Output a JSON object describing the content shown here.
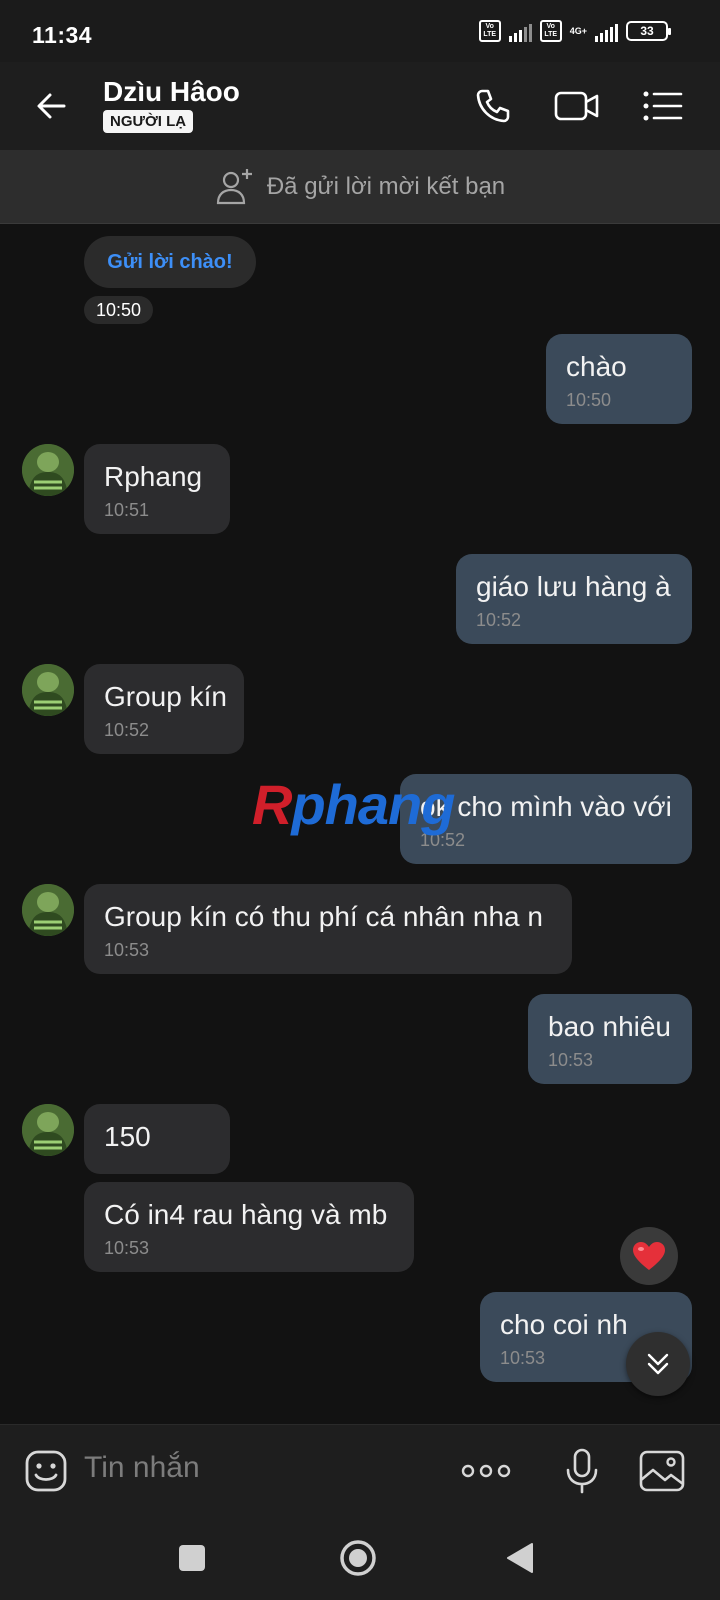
{
  "status_bar": {
    "time": "11:34",
    "volte_1": "Vo LTE",
    "volte_2": "Vo LTE",
    "network": "4G+",
    "battery": "33"
  },
  "header": {
    "contact_name": "Dzìu Hâoo",
    "badge": "NGƯỜI LẠ",
    "icons": [
      "back-arrow-icon",
      "phone-icon",
      "video-call-icon",
      "menu-list-icon"
    ]
  },
  "friend_banner": {
    "text": "Đã gửi lời mời kết bạn",
    "icon": "add-person-icon"
  },
  "chat": {
    "greeting_chip": "Gửi lời chào!",
    "greeting_time": "10:50",
    "messages": [
      {
        "dir": "out",
        "text": "chào",
        "time": "10:50"
      },
      {
        "dir": "in",
        "text": "Rphang",
        "time": "10:51"
      },
      {
        "dir": "out",
        "text": "giáo lưu hàng à",
        "time": "10:52"
      },
      {
        "dir": "in",
        "text": "Group kín",
        "time": "10:52"
      },
      {
        "dir": "out",
        "text": "ok cho mình vào với",
        "time": "10:52"
      },
      {
        "dir": "in",
        "text": "Group kín có thu phí cá nhân nha n",
        "time": "10:53"
      },
      {
        "dir": "out",
        "text": "bao nhiêu",
        "time": "10:53"
      },
      {
        "dir": "in",
        "text": "150",
        "time": ""
      },
      {
        "dir": "in",
        "text": "Có in4 rau hàng và mb",
        "time": "10:53"
      },
      {
        "dir": "out",
        "text": "cho coi nh",
        "time": "10:53"
      }
    ],
    "reaction": "heart-icon",
    "watermark_r": "R",
    "watermark_rest": "phang"
  },
  "input_bar": {
    "placeholder": "Tin nhắn",
    "icons": [
      "emoji-icon",
      "more-options-icon",
      "microphone-icon",
      "image-icon"
    ]
  },
  "colors": {
    "background": "#121212",
    "bubble_in": "#2c2c2e",
    "bubble_out": "#3b4a5a",
    "accent_blue": "#3d8ff7",
    "heart": "#e5303a"
  }
}
